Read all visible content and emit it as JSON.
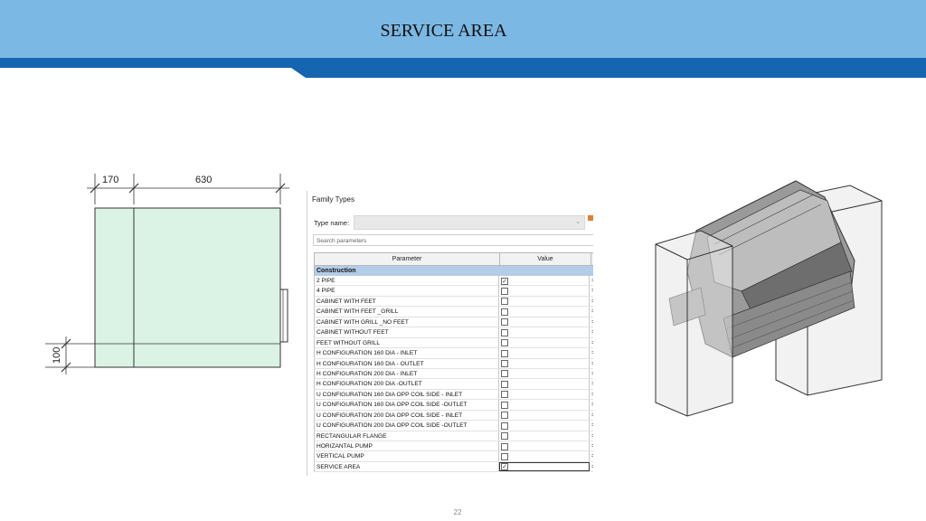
{
  "header": {
    "title": "SERVICE AREA",
    "bar_color": "#7cb8e4",
    "band_color": "#1565b0"
  },
  "drawing": {
    "dim_width_small": "170",
    "dim_width_large": "630",
    "dim_height": "100",
    "fill_color": "#daf3e4"
  },
  "family_types": {
    "title": "Family Types",
    "type_name_label": "Type name:",
    "type_name_value": "",
    "search_placeholder": "Search parameters",
    "col_parameter": "Parameter",
    "col_value": "Value",
    "group": "Construction",
    "rows": [
      {
        "name": "2 PIPE",
        "checked": true
      },
      {
        "name": "4 PIPE",
        "checked": false
      },
      {
        "name": "CABINET WITH FEET",
        "checked": false
      },
      {
        "name": "CABINET WITH FEET _GRILL",
        "checked": false
      },
      {
        "name": "CABINET WITH GRILL _NO FEET",
        "checked": false
      },
      {
        "name": "CABINET WITHOUT FEET",
        "checked": false
      },
      {
        "name": "FEET WITHOUT GRILL",
        "checked": false
      },
      {
        "name": "H CONFIGURATION 160 DIA - INLET",
        "checked": false
      },
      {
        "name": "H CONFIGURATION 160 DIA - OUTLET",
        "checked": false
      },
      {
        "name": "H CONFIGURATION 200 DIA - INLET",
        "checked": false
      },
      {
        "name": "H CONFIGURATION 200 DIA -OUTLET",
        "checked": false
      },
      {
        "name": "U CONFIGURATION 160 DIA OPP  COIL SIDE - INLET",
        "checked": false
      },
      {
        "name": "U CONFIGURATION 160 DIA OPP  COIL SIDE -OUTLET",
        "checked": false
      },
      {
        "name": "U CONFIGURATION 200 DIA OPP COIL SIDE - INLET",
        "checked": false
      },
      {
        "name": "U CONFIGURATION 200 DIA OPP COIL SIDE -OUTLET",
        "checked": false
      },
      {
        "name": "RECTANGULAR FLANGE",
        "checked": false
      },
      {
        "name": "HORIZANTAL PUMP",
        "checked": false
      },
      {
        "name": "VERTICAL PUMP",
        "checked": false
      },
      {
        "name": "SERVICE AREA",
        "checked": true,
        "selected": true
      }
    ]
  },
  "page_number": "22"
}
